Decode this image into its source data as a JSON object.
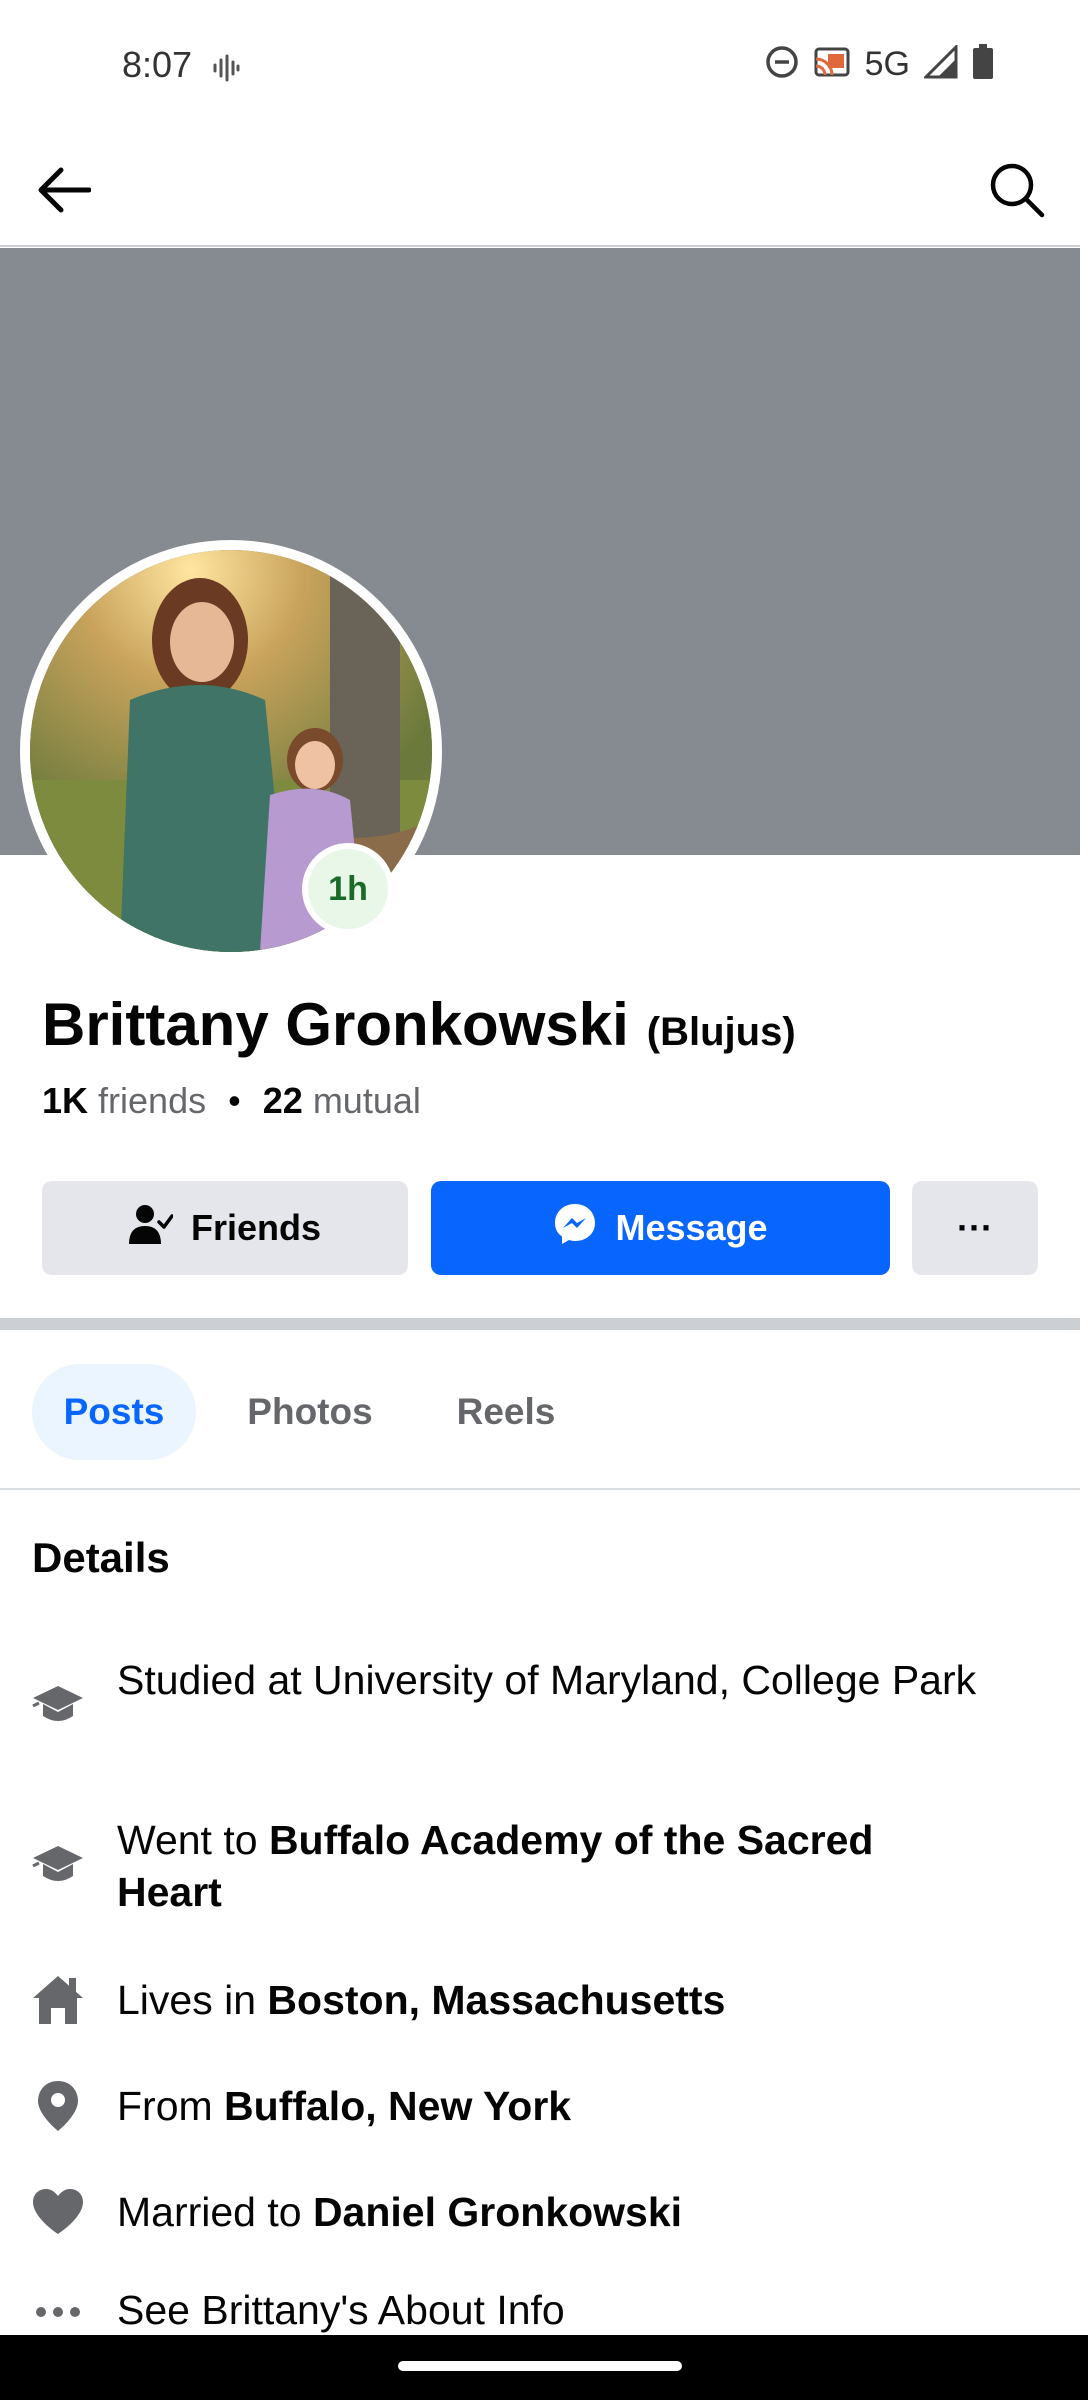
{
  "status_bar": {
    "time": "8:07",
    "network": "5G",
    "icons": [
      "voice-wave-icon",
      "do-not-disturb-icon",
      "cast-icon",
      "signal-icon",
      "battery-icon"
    ]
  },
  "nav": {
    "back_icon": "arrow-left-icon",
    "search_icon": "search-icon"
  },
  "profile": {
    "name": "Brittany Gronkowski",
    "alternate_name": "(Blujus)",
    "story_badge": "1h",
    "friends_count": "1K",
    "friends_label": "friends",
    "separator": "•",
    "mutual_count": "22",
    "mutual_label": "mutual"
  },
  "actions": {
    "friends_label": "Friends",
    "message_label": "Message",
    "more_label": "···"
  },
  "tabs": [
    {
      "label": "Posts",
      "active": true
    },
    {
      "label": "Photos",
      "active": false
    },
    {
      "label": "Reels",
      "active": false
    }
  ],
  "details": {
    "title": "Details",
    "items": [
      {
        "icon": "graduation-cap-icon",
        "prefix": "Studied at University of Maryland, College Park",
        "bold": ""
      },
      {
        "icon": "graduation-cap-icon",
        "prefix": "Went to ",
        "bold": "Buffalo Academy of the Sacred Heart"
      },
      {
        "icon": "home-icon",
        "prefix": "Lives in ",
        "bold": "Boston, Massachusetts"
      },
      {
        "icon": "location-pin-icon",
        "prefix": "From ",
        "bold": "Buffalo, New York"
      },
      {
        "icon": "heart-icon",
        "prefix": "Married to ",
        "bold": "Daniel Gronkowski"
      },
      {
        "icon": "more-dots-icon",
        "prefix": "See Brittany's About Info",
        "bold": ""
      }
    ]
  },
  "colors": {
    "brand_blue": "#0866ff",
    "cover_gray": "#868a91",
    "button_gray": "#e4e6eb",
    "secondary_text": "#65676b"
  }
}
